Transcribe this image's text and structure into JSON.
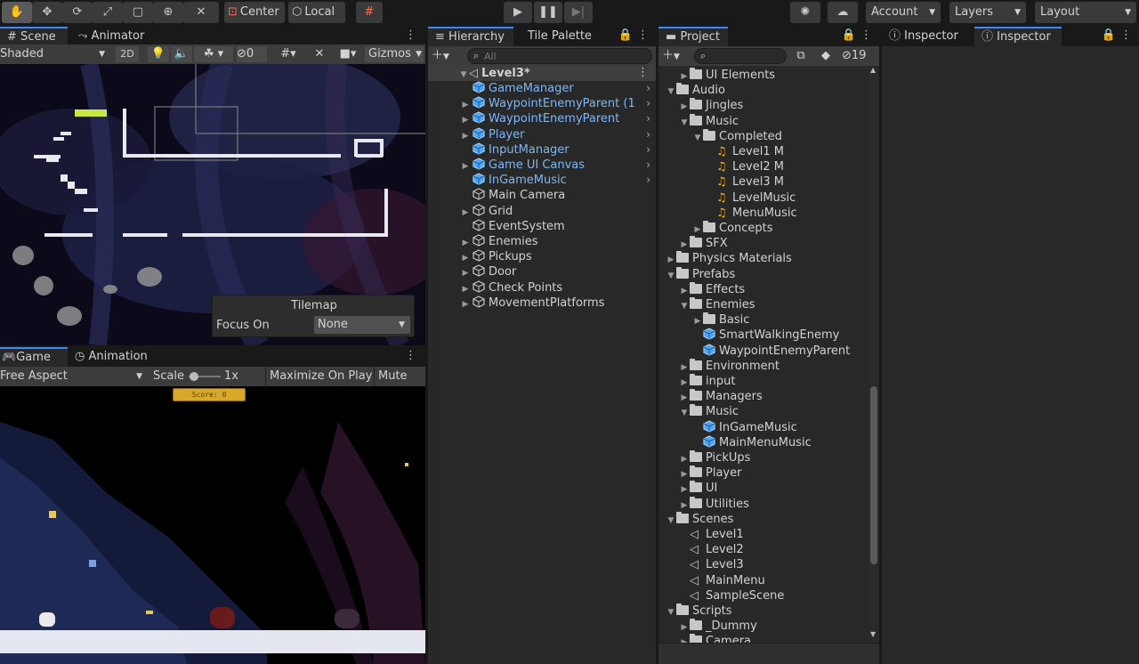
{
  "toolbar": {
    "center_label": "Center",
    "local_label": "Local",
    "account_label": "Account",
    "layers_label": "Layers",
    "layout_label": "Layout"
  },
  "scene_panel": {
    "tabs": [
      "Scene",
      "Animator"
    ],
    "shading": "Shaded",
    "mode_2d": "2D",
    "hidden_count": "0",
    "gizmos": "Gizmos",
    "tilemap_title": "Tilemap",
    "focus_label": "Focus On",
    "focus_value": "None"
  },
  "game_panel": {
    "tabs": [
      "Game",
      "Animation"
    ],
    "aspect": "Free Aspect",
    "scale_label": "Scale",
    "scale_value": "1x",
    "maximize_label": "Maximize On Play",
    "mute_label": "Mute Au",
    "score_text": "Score: 0"
  },
  "hierarchy": {
    "tabs": [
      "Hierarchy",
      "Tile Palette"
    ],
    "search_placeholder": "All",
    "scene_name": "Level3*",
    "items": [
      {
        "label": "GameManager",
        "prefab": true,
        "expandable": false,
        "chevron": true
      },
      {
        "label": "WaypointEnemyParent (1",
        "prefab": true,
        "expandable": true,
        "chevron": true
      },
      {
        "label": "WaypointEnemyParent",
        "prefab": true,
        "expandable": true,
        "chevron": true
      },
      {
        "label": "Player",
        "prefab": true,
        "expandable": true,
        "chevron": true
      },
      {
        "label": "InputManager",
        "prefab": true,
        "expandable": false,
        "chevron": true
      },
      {
        "label": "Game UI Canvas",
        "prefab": true,
        "expandable": true,
        "chevron": true
      },
      {
        "label": "InGameMusic",
        "prefab": true,
        "expandable": false,
        "chevron": true
      },
      {
        "label": "Main Camera",
        "prefab": false,
        "expandable": false,
        "chevron": false
      },
      {
        "label": "Grid",
        "prefab": false,
        "expandable": true,
        "chevron": false
      },
      {
        "label": "EventSystem",
        "prefab": false,
        "expandable": false,
        "chevron": false
      },
      {
        "label": "Enemies",
        "prefab": false,
        "expandable": true,
        "chevron": false
      },
      {
        "label": "Pickups",
        "prefab": false,
        "expandable": true,
        "chevron": false
      },
      {
        "label": "Door",
        "prefab": false,
        "expandable": true,
        "chevron": false
      },
      {
        "label": "Check Points",
        "prefab": false,
        "expandable": true,
        "chevron": false
      },
      {
        "label": "MovementPlatforms",
        "prefab": false,
        "expandable": true,
        "chevron": false
      }
    ]
  },
  "project": {
    "tab": "Project",
    "hidden_count": "19",
    "items": [
      {
        "label": "UI Elements",
        "indent": 1,
        "type": "folder",
        "state": "collapsed"
      },
      {
        "label": "Audio",
        "indent": 0,
        "type": "folder",
        "state": "expanded"
      },
      {
        "label": "Jingles",
        "indent": 1,
        "type": "folder",
        "state": "collapsed"
      },
      {
        "label": "Music",
        "indent": 1,
        "type": "folder",
        "state": "expanded"
      },
      {
        "label": "Completed",
        "indent": 2,
        "type": "folder",
        "state": "expanded"
      },
      {
        "label": "Level1 M",
        "indent": 3,
        "type": "audio",
        "state": "none"
      },
      {
        "label": "Level2 M",
        "indent": 3,
        "type": "audio",
        "state": "none"
      },
      {
        "label": "Level3 M",
        "indent": 3,
        "type": "audio",
        "state": "none"
      },
      {
        "label": "LevelMusic",
        "indent": 3,
        "type": "audio",
        "state": "none"
      },
      {
        "label": "MenuMusic",
        "indent": 3,
        "type": "audio",
        "state": "none"
      },
      {
        "label": "Concepts",
        "indent": 2,
        "type": "folder",
        "state": "collapsed"
      },
      {
        "label": "SFX",
        "indent": 1,
        "type": "folder",
        "state": "collapsed"
      },
      {
        "label": "Physics Materials",
        "indent": 0,
        "type": "folder",
        "state": "collapsed"
      },
      {
        "label": "Prefabs",
        "indent": 0,
        "type": "folder",
        "state": "expanded"
      },
      {
        "label": "Effects",
        "indent": 1,
        "type": "folder",
        "state": "collapsed"
      },
      {
        "label": "Enemies",
        "indent": 1,
        "type": "folder",
        "state": "expanded"
      },
      {
        "label": "Basic",
        "indent": 2,
        "type": "folder",
        "state": "collapsed"
      },
      {
        "label": "SmartWalkingEnemy",
        "indent": 2,
        "type": "prefab",
        "state": "none"
      },
      {
        "label": "WaypointEnemyParent",
        "indent": 2,
        "type": "prefab",
        "state": "none"
      },
      {
        "label": "Environment",
        "indent": 1,
        "type": "folder",
        "state": "collapsed"
      },
      {
        "label": "input",
        "indent": 1,
        "type": "folder",
        "state": "collapsed"
      },
      {
        "label": "Managers",
        "indent": 1,
        "type": "folder",
        "state": "collapsed"
      },
      {
        "label": "Music",
        "indent": 1,
        "type": "folder",
        "state": "expanded"
      },
      {
        "label": "InGameMusic",
        "indent": 2,
        "type": "prefab",
        "state": "none"
      },
      {
        "label": "MainMenuMusic",
        "indent": 2,
        "type": "prefab",
        "state": "none"
      },
      {
        "label": "PickUps",
        "indent": 1,
        "type": "folder",
        "state": "collapsed"
      },
      {
        "label": "Player",
        "indent": 1,
        "type": "folder",
        "state": "collapsed"
      },
      {
        "label": "UI",
        "indent": 1,
        "type": "folder",
        "state": "collapsed"
      },
      {
        "label": "Utilities",
        "indent": 1,
        "type": "folder",
        "state": "collapsed"
      },
      {
        "label": "Scenes",
        "indent": 0,
        "type": "folder",
        "state": "expanded"
      },
      {
        "label": "Level1",
        "indent": 1,
        "type": "scene",
        "state": "none"
      },
      {
        "label": "Level2",
        "indent": 1,
        "type": "scene",
        "state": "none"
      },
      {
        "label": "Level3",
        "indent": 1,
        "type": "scene",
        "state": "none"
      },
      {
        "label": "MainMenu",
        "indent": 1,
        "type": "scene",
        "state": "none"
      },
      {
        "label": "SampleScene",
        "indent": 1,
        "type": "scene",
        "state": "none"
      },
      {
        "label": "Scripts",
        "indent": 0,
        "type": "folder",
        "state": "expanded"
      },
      {
        "label": "_Dummy",
        "indent": 1,
        "type": "folder",
        "state": "collapsed"
      },
      {
        "label": "Camera",
        "indent": 1,
        "type": "folder",
        "state": "collapsed"
      }
    ]
  },
  "inspector": {
    "tabs": [
      "Inspector",
      "Inspector"
    ]
  },
  "colors": {
    "accent": "#3d87ff",
    "prefab_text": "#7cb8f7",
    "audio_icon": "#f2b01e"
  }
}
